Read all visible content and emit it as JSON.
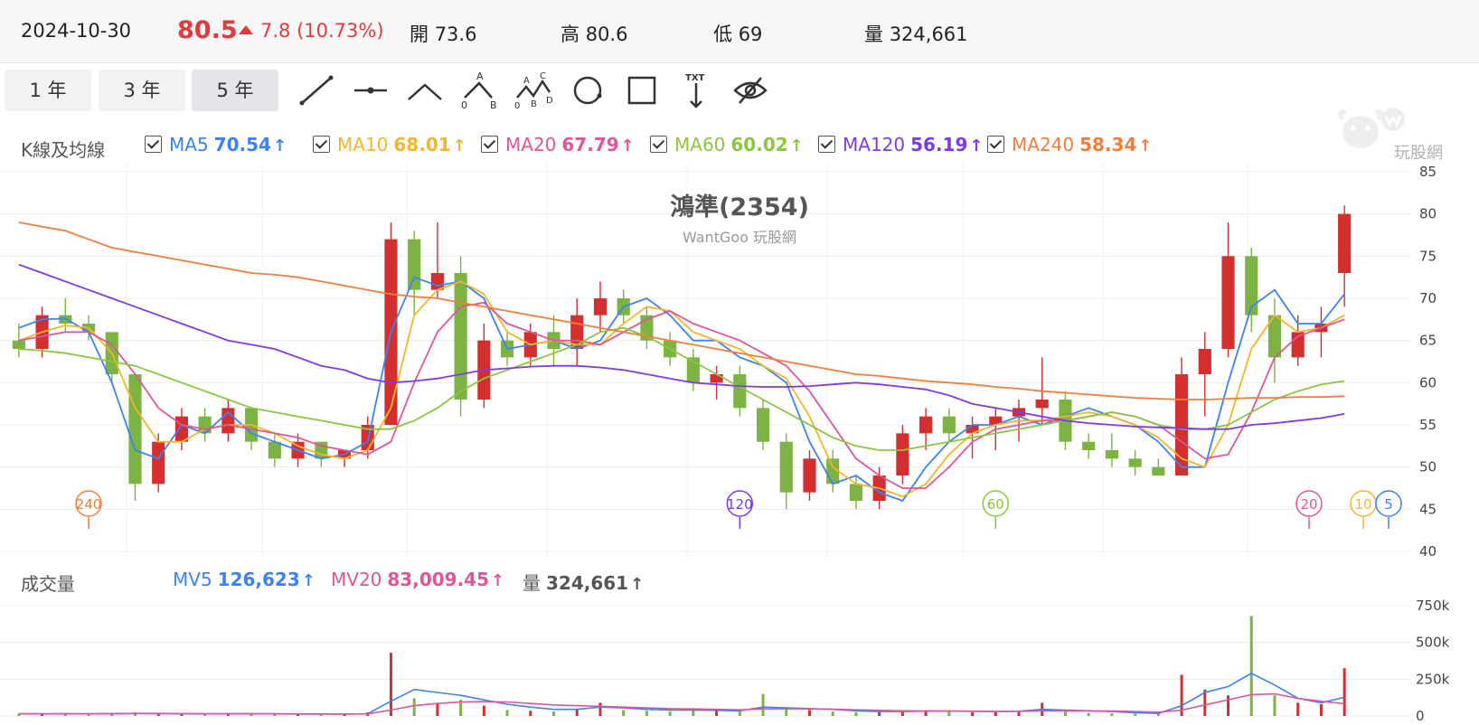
{
  "quote": {
    "date": "2024-10-30",
    "price": "80.5",
    "change": "7.8 (10.73%)",
    "open_label": "開",
    "open": "73.6",
    "high_label": "高",
    "high": "80.6",
    "low_label": "低",
    "low": "69",
    "volume_label": "量",
    "volume": "324,661"
  },
  "toolbar": {
    "ranges": [
      "1 年",
      "3 年",
      "5 年"
    ],
    "active_range": "5 年",
    "tools": [
      "line-tool-icon",
      "horizontal-line-tool-icon",
      "angle-tool-icon",
      "abc-wave-tool-icon",
      "abcd-wave-tool-icon",
      "circle-tool-icon",
      "rectangle-tool-icon",
      "text-tool-icon",
      "hide-drawings-icon"
    ],
    "abc_labels": [
      "A",
      "B",
      "0"
    ],
    "abcd_labels": [
      "A",
      "B",
      "C",
      "D",
      "0"
    ],
    "text_tool_label": "TXT"
  },
  "ma_panel": {
    "title": "K線及均線",
    "items": [
      {
        "name": "MA5",
        "value": "70.54",
        "color": "#3b82f6"
      },
      {
        "name": "MA10",
        "value": "68.01",
        "color": "#f5b529"
      },
      {
        "name": "MA20",
        "value": "67.79",
        "color": "#e0559a"
      },
      {
        "name": "MA60",
        "value": "60.02",
        "color": "#8cc63f"
      },
      {
        "name": "MA120",
        "value": "56.19",
        "color": "#7c3aed"
      },
      {
        "name": "MA240",
        "value": "58.34",
        "color": "#f47c3c"
      }
    ]
  },
  "watermark": {
    "title": "鴻準(2354)",
    "subtitle": "WantGoo 玩股網",
    "logo_text": "玩股網"
  },
  "volume_panel": {
    "title": "成交量",
    "items": [
      {
        "name": "MV5",
        "value": "126,623",
        "color": "#3b82f6"
      },
      {
        "name": "MV20",
        "value": "83,009.45",
        "color": "#e0559a"
      },
      {
        "name": "量",
        "value": "324,661",
        "color": "#555555"
      }
    ]
  },
  "chart_data": [
    {
      "type": "candlestick",
      "title": "鴻準(2354)",
      "ylim": [
        40,
        85
      ],
      "yticks": [
        "85",
        "80",
        "75",
        "70",
        "65",
        "60",
        "55",
        "50",
        "45",
        "40"
      ],
      "up_color": "#d32f2f",
      "down_color": "#7cb342",
      "ma_markers": [
        "240",
        "120",
        "60",
        "20",
        "10",
        "5"
      ],
      "series": [
        {
          "name": "MA5",
          "color": "#3b82f6",
          "values": [
            66.5,
            67.5,
            67.6,
            66.0,
            60.0,
            52.0,
            51.0,
            55.0,
            54.0,
            56.5,
            54.0,
            53.0,
            52.0,
            51.0,
            51.5,
            53.0,
            66.0,
            72.5,
            71.5,
            72.0,
            70.0,
            64.0,
            64.5,
            65.0,
            64.0,
            65.0,
            69.0,
            70.0,
            68.0,
            65.0,
            65.0,
            63.0,
            62.0,
            60.0,
            53.0,
            48.0,
            49.0,
            47.0,
            46.0,
            50.0,
            53.0,
            55.0,
            55.0,
            56.0,
            55.0,
            56.0,
            57.0,
            56.0,
            55.0,
            53.0,
            50.0,
            50.0,
            60.0,
            69.0,
            71.0,
            67.0,
            67.0,
            70.5
          ]
        },
        {
          "name": "MA10",
          "color": "#f5b529",
          "values": [
            65.0,
            66.0,
            66.8,
            66.5,
            63.5,
            57.0,
            53.0,
            53.0,
            54.5,
            55.0,
            55.0,
            54.0,
            52.5,
            51.5,
            51.0,
            52.0,
            57.0,
            68.0,
            71.0,
            72.0,
            70.5,
            66.0,
            64.5,
            65.0,
            64.5,
            64.5,
            67.0,
            69.0,
            68.5,
            66.0,
            65.0,
            64.0,
            62.0,
            60.5,
            56.0,
            50.0,
            48.0,
            47.5,
            46.5,
            48.0,
            51.5,
            54.0,
            55.0,
            55.5,
            55.5,
            56.0,
            56.5,
            56.0,
            55.0,
            53.5,
            51.0,
            50.0,
            55.0,
            64.0,
            68.0,
            66.0,
            66.5,
            68.0
          ]
        },
        {
          "name": "MA20",
          "color": "#e0559a",
          "values": [
            65.0,
            65.5,
            66.0,
            66.0,
            64.5,
            61.0,
            57.0,
            55.0,
            54.5,
            55.0,
            54.5,
            54.0,
            53.5,
            52.5,
            52.0,
            51.5,
            53.0,
            60.0,
            66.0,
            69.0,
            69.5,
            67.0,
            66.0,
            65.0,
            65.0,
            64.5,
            66.0,
            67.5,
            68.5,
            67.0,
            66.0,
            65.0,
            63.5,
            62.0,
            59.0,
            55.0,
            51.0,
            49.0,
            47.5,
            47.5,
            50.0,
            53.0,
            54.5,
            55.0,
            55.5,
            55.5,
            56.0,
            56.5,
            56.0,
            55.0,
            53.0,
            51.0,
            51.5,
            56.5,
            63.0,
            65.5,
            66.5,
            67.5
          ]
        },
        {
          "name": "MA60",
          "color": "#8cc63f",
          "values": [
            64.0,
            63.8,
            63.5,
            63.0,
            62.5,
            62.0,
            61.0,
            60.0,
            59.0,
            58.0,
            57.0,
            56.5,
            56.0,
            55.5,
            55.0,
            54.5,
            54.5,
            55.5,
            57.0,
            59.0,
            60.5,
            61.5,
            62.5,
            63.5,
            64.5,
            66.0,
            66.5,
            65.5,
            64.0,
            62.5,
            61.0,
            59.5,
            58.0,
            56.5,
            55.0,
            53.5,
            52.5,
            52.0,
            52.0,
            52.5,
            53.0,
            53.5,
            54.0,
            54.5,
            55.0,
            55.5,
            56.0,
            56.5,
            56.0,
            55.0,
            54.5,
            54.5,
            55.0,
            56.5,
            58.0,
            59.0,
            59.8,
            60.2
          ]
        },
        {
          "name": "MA120",
          "color": "#7c3aed",
          "values": [
            74.0,
            73.0,
            72.0,
            71.0,
            70.0,
            69.0,
            68.0,
            67.0,
            66.0,
            65.0,
            64.5,
            64.0,
            63.0,
            62.0,
            61.5,
            60.5,
            60.0,
            60.2,
            60.5,
            61.0,
            61.5,
            61.7,
            61.9,
            62.0,
            62.0,
            61.8,
            61.5,
            61.0,
            60.5,
            60.0,
            59.8,
            59.6,
            59.5,
            59.5,
            59.6,
            59.8,
            60.0,
            59.8,
            59.5,
            59.2,
            58.5,
            57.5,
            57.0,
            56.5,
            56.0,
            55.5,
            55.2,
            55.0,
            54.8,
            54.7,
            54.6,
            54.5,
            54.5,
            55.0,
            55.2,
            55.5,
            55.8,
            56.3
          ]
        },
        {
          "name": "MA240",
          "color": "#f47c3c",
          "values": [
            79.0,
            78.5,
            78.0,
            77.0,
            76.0,
            75.5,
            75.0,
            74.5,
            74.0,
            73.5,
            73.0,
            72.8,
            72.5,
            72.0,
            71.5,
            71.0,
            70.5,
            70.2,
            70.0,
            69.5,
            69.0,
            68.5,
            68.0,
            67.5,
            67.0,
            66.5,
            66.0,
            65.5,
            65.0,
            64.5,
            64.0,
            63.5,
            63.0,
            62.5,
            62.0,
            61.5,
            61.0,
            60.8,
            60.5,
            60.2,
            60.0,
            59.8,
            59.5,
            59.3,
            59.0,
            58.8,
            58.6,
            58.4,
            58.2,
            58.1,
            58.0,
            58.0,
            58.1,
            58.2,
            58.2,
            58.3,
            58.3,
            58.4
          ]
        }
      ],
      "candles": [
        [
          65,
          67,
          63,
          64
        ],
        [
          64,
          69,
          63,
          68
        ],
        [
          68,
          70,
          66,
          67
        ],
        [
          67,
          68,
          65,
          66
        ],
        [
          66,
          66,
          60,
          61
        ],
        [
          61,
          61,
          46,
          48
        ],
        [
          48,
          54,
          47,
          53
        ],
        [
          53,
          57,
          52,
          56
        ],
        [
          56,
          57,
          53,
          54
        ],
        [
          54,
          58,
          53,
          57
        ],
        [
          57,
          57,
          52,
          53
        ],
        [
          53,
          54,
          50,
          51
        ],
        [
          51,
          54,
          50,
          53
        ],
        [
          53,
          53,
          50,
          51
        ],
        [
          51,
          52,
          50,
          52
        ],
        [
          52,
          56,
          51,
          55
        ],
        [
          55,
          79,
          55,
          77
        ],
        [
          77,
          78,
          68,
          71
        ],
        [
          71,
          79,
          70,
          73
        ],
        [
          73,
          75,
          56,
          58
        ],
        [
          58,
          67,
          57,
          65
        ],
        [
          65,
          66,
          62,
          63
        ],
        [
          63,
          67,
          62,
          66
        ],
        [
          66,
          68,
          62,
          64
        ],
        [
          64,
          70,
          62,
          68
        ],
        [
          68,
          72,
          66,
          70
        ],
        [
          70,
          71,
          67,
          68
        ],
        [
          68,
          69,
          64,
          65
        ],
        [
          65,
          66,
          62,
          63
        ],
        [
          63,
          64,
          59,
          60
        ],
        [
          60,
          62,
          58,
          61
        ],
        [
          61,
          62,
          56,
          57
        ],
        [
          57,
          58,
          52,
          53
        ],
        [
          53,
          54,
          45,
          47
        ],
        [
          47,
          52,
          46,
          51
        ],
        [
          51,
          52,
          47,
          48
        ],
        [
          48,
          49,
          45,
          46
        ],
        [
          46,
          50,
          45,
          49
        ],
        [
          49,
          55,
          48,
          54
        ],
        [
          54,
          57,
          52,
          56
        ],
        [
          56,
          57,
          53,
          54
        ],
        [
          54,
          56,
          51,
          55
        ],
        [
          55,
          57,
          52,
          56
        ],
        [
          56,
          58,
          53,
          57
        ],
        [
          57,
          63,
          55,
          58
        ],
        [
          58,
          59,
          52,
          53
        ],
        [
          53,
          54,
          51,
          52
        ],
        [
          52,
          54,
          50,
          51
        ],
        [
          51,
          52,
          49,
          50
        ],
        [
          50,
          51,
          49,
          49
        ],
        [
          49,
          63,
          49,
          61
        ],
        [
          61,
          66,
          56,
          64
        ],
        [
          64,
          79,
          63,
          75
        ],
        [
          75,
          76,
          66,
          68
        ],
        [
          68,
          70,
          60,
          63
        ],
        [
          63,
          68,
          62,
          66
        ],
        [
          66,
          69,
          63,
          67
        ],
        [
          73,
          81,
          69,
          80
        ]
      ]
    },
    {
      "type": "bar",
      "title": "成交量",
      "ylim": [
        0,
        750000
      ],
      "yticks": [
        "750k",
        "500k",
        "250k",
        "0"
      ],
      "values": [
        15000,
        12000,
        18000,
        10000,
        20000,
        25000,
        15000,
        12000,
        14000,
        18000,
        16000,
        12000,
        10000,
        11000,
        12000,
        25000,
        430000,
        120000,
        90000,
        110000,
        70000,
        40000,
        35000,
        30000,
        45000,
        90000,
        40000,
        35000,
        30000,
        45000,
        38000,
        30000,
        150000,
        60000,
        40000,
        30000,
        25000,
        28000,
        35000,
        40000,
        30000,
        25000,
        28000,
        35000,
        90000,
        30000,
        20000,
        18000,
        15000,
        14000,
        280000,
        180000,
        140000,
        680000,
        140000,
        90000,
        80000,
        324661
      ],
      "series": [
        {
          "name": "MV5",
          "color": "#3b82f6",
          "values": [
            15000,
            14000,
            15000,
            14000,
            16000,
            17000,
            17000,
            15000,
            14000,
            15000,
            15000,
            14000,
            13000,
            12000,
            12000,
            15000,
            100000,
            180000,
            160000,
            140000,
            110000,
            80000,
            60000,
            45000,
            45000,
            60000,
            55000,
            45000,
            40000,
            40000,
            38000,
            35000,
            60000,
            55000,
            50000,
            45000,
            35000,
            30000,
            30000,
            33000,
            34000,
            32000,
            30000,
            32000,
            45000,
            40000,
            35000,
            30000,
            22000,
            17000,
            70000,
            160000,
            200000,
            290000,
            210000,
            120000,
            90000,
            126623
          ]
        },
        {
          "name": "MV20",
          "color": "#e0559a",
          "values": [
            15000,
            15000,
            15000,
            15000,
            15000,
            16000,
            16000,
            16000,
            15000,
            15000,
            15000,
            15000,
            14000,
            14000,
            13000,
            14000,
            40000,
            70000,
            85000,
            95000,
            98000,
            95000,
            85000,
            75000,
            70000,
            65000,
            60000,
            55000,
            50000,
            48000,
            45000,
            42000,
            48000,
            50000,
            48000,
            46000,
            42000,
            38000,
            35000,
            34000,
            33000,
            32000,
            31000,
            31000,
            35000,
            35000,
            34000,
            33000,
            30000,
            26000,
            40000,
            75000,
            110000,
            145000,
            150000,
            120000,
            100000,
            83009
          ]
        }
      ]
    }
  ]
}
